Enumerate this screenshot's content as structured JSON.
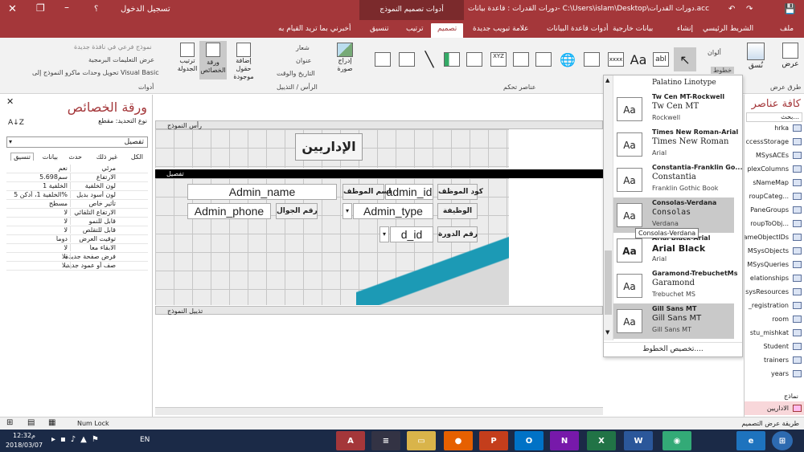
{
  "titlebar": {
    "login": "تسجيل الدخول",
    "help": "؟",
    "context_tab": "أدوات تصميم النموذج",
    "path": "دورات القدرات : قاعدة بيانات- C:\\Users\\islam\\Desktop\\دورات القدرات.accdb (تنـ...",
    "tell_me": "أخبرني بما تريد القيام به"
  },
  "tabs": [
    {
      "label": "ملف"
    },
    {
      "label": "الشريط الرئيسي"
    },
    {
      "label": "إنشاء"
    },
    {
      "label": "بيانات خارجية"
    },
    {
      "label": "أدوات قاعدة البيانات"
    },
    {
      "label": "علامة تبويب جديدة"
    },
    {
      "label": "تصميم"
    },
    {
      "label": "ترتيب"
    },
    {
      "label": "تنسيق"
    }
  ],
  "ribbon": {
    "views_label": "عرض",
    "views_group": "طرق عرض",
    "themes_label": "نُسق",
    "colors_label": "ألوان",
    "fonts_label": "خطوط",
    "controls_group": "عناصر تحكم",
    "insert_image": "إدراج صورة",
    "logo": "شعار",
    "title": "عنوان",
    "datetime": "التاريخ والوقت",
    "header_group": "الرأس / التذييل",
    "add_fields": "إضافة حقول موجودة",
    "prop_sheet": "ورقة الخصائص",
    "tab_order": "ترتيب الجدولة",
    "subform": "نموذج فرعي في نافذة جديدة",
    "view_code": "عرض التعليمات البرمجية",
    "convert_macros": "تحويل وحدات ماكرو النموذج إلى Visual Basic",
    "tools_group": "أدوات"
  },
  "propsheet": {
    "title": "ورقة الخصائص",
    "sel_label": "نوع التحديد: مقطع",
    "selected": "تفصيل",
    "tabs": [
      "الكل",
      "غير ذلك",
      "حدث",
      "بيانات",
      "تنسيق"
    ],
    "rows": [
      {
        "name": "مرئي",
        "value": "نعم"
      },
      {
        "name": "الارتفاع",
        "value": "5.698سم"
      },
      {
        "name": "لون الخلفية",
        "value": "الخلفية 1"
      },
      {
        "name": "لون أسود بديل",
        "value": "الخلفية 1، أدكن 5%"
      },
      {
        "name": "تأثير خاص",
        "value": "مسطح"
      },
      {
        "name": "الارتفاع التلقائي",
        "value": "لا"
      },
      {
        "name": "قابل للنمو",
        "value": "لا"
      },
      {
        "name": "قابل للتقلص",
        "value": "لا"
      },
      {
        "name": "توقيت العرض",
        "value": "دوماً"
      },
      {
        "name": "الابقاء معاً",
        "value": "لا"
      },
      {
        "name": "فرض صفحة جديدة",
        "value": "بلا"
      },
      {
        "name": "صف أو عمود جديد",
        "value": "بلا"
      }
    ]
  },
  "form": {
    "header_bar": "رأس النموذج",
    "detail_bar": "تفصيل",
    "footer_bar": "تذييل النموذج",
    "title": "الإداريين",
    "fields": [
      {
        "label": "كود الموظف",
        "value": "admin_id"
      },
      {
        "label": "اسم الموظف",
        "value": "Admin_name"
      },
      {
        "label": "الوظيفة",
        "value": "Admin_type"
      },
      {
        "label": "رقم الجوال",
        "value": "Admin_phone"
      },
      {
        "label": "رقم الدورة",
        "value": "d_id"
      }
    ]
  },
  "fonts": {
    "top": "Palatino Linotype",
    "items": [
      {
        "name": "Tw Cen MT-Rockwell",
        "heading": "Tw Cen MT",
        "body": "Rockwell",
        "selected": false
      },
      {
        "name": "Times New Roman-Arial",
        "heading": "Times New Roman",
        "body": "Arial",
        "selected": false
      },
      {
        "name": "Constantia-Franklin Go...",
        "heading": "Constantia",
        "body": "Franklin Gothic Book",
        "selected": false
      },
      {
        "name": "Consolas-Verdana",
        "heading": "Consolas",
        "body": "Verdana",
        "selected": true
      },
      {
        "name": "Arial Black-Arial",
        "heading": "Arial Black",
        "body": "Arial",
        "selected": false
      },
      {
        "name": "Garamond-TrebuchetMs",
        "heading": "Garamond",
        "body": "Trebuchet MS",
        "selected": false
      },
      {
        "name": "Gill Sans MT",
        "heading": "Gill Sans MT",
        "body": "Gill Sans MT",
        "selected": true
      }
    ],
    "sample": "Aa",
    "customize": "تخصيص الخطوط....",
    "tooltip": "Consolas-Verdana"
  },
  "nav": {
    "title": "كافة عناصر",
    "search": "بحث...",
    "items": [
      "hrka",
      "ccessStorage",
      "MSysACEs",
      "plexColumns",
      "sNameMap",
      "roupCateg...",
      "PaneGroups",
      "roupToObj...",
      "ameObjectIDs",
      "MSysObjects",
      "MSysQueries",
      "elationships",
      "sysResources",
      "_registration",
      "room",
      "stu_mishkat",
      "Student",
      "trainers",
      "years"
    ],
    "forms_group": "نماذج",
    "form_item": "الاداريين"
  },
  "status": {
    "left": "طريقة عرض التصميم",
    "numlock": "Num Lock"
  },
  "taskbar": {
    "time": "12:32م",
    "date": "2018/03/07",
    "lang": "EN"
  },
  "colors": {
    "accent": "#a4373a",
    "ribbon": "#f2f2f2",
    "taskbar": "#1b2a47",
    "teal": "#1c9ab5"
  }
}
